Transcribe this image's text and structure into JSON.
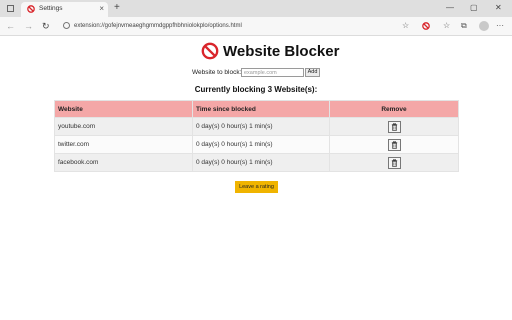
{
  "browser": {
    "tab_title": "Settings",
    "url": "extension://gofejnvmeaeghgmmdgppfhbhniolokplo/options.html",
    "newtab_label": "+",
    "tab_close_label": "×",
    "window_controls": [
      "—",
      "▢",
      "✕"
    ]
  },
  "page": {
    "title": "Website Blocker",
    "add_label": "Website to block:",
    "add_placeholder": "example.com",
    "add_input_value": "",
    "add_button": "Add",
    "count_text": "Currently blocking 3 Website(s):"
  },
  "table": {
    "columns": [
      "Website",
      "Time since blocked",
      "Remove"
    ],
    "rows": [
      {
        "site": "youtube.com",
        "time": "0 day(s) 0 hour(s) 1 min(s)"
      },
      {
        "site": "twitter.com",
        "time": "0 day(s) 0 hour(s) 1 min(s)"
      },
      {
        "site": "facebook.com",
        "time": "0 day(s) 0 hour(s) 1 min(s)"
      }
    ],
    "remove_icon": "trash-icon"
  },
  "rate_button": "Leave a rating",
  "colors": {
    "header_bg": "#f4a7a7",
    "rate_button": "#f0b400",
    "logo_red": "#d9252b"
  }
}
